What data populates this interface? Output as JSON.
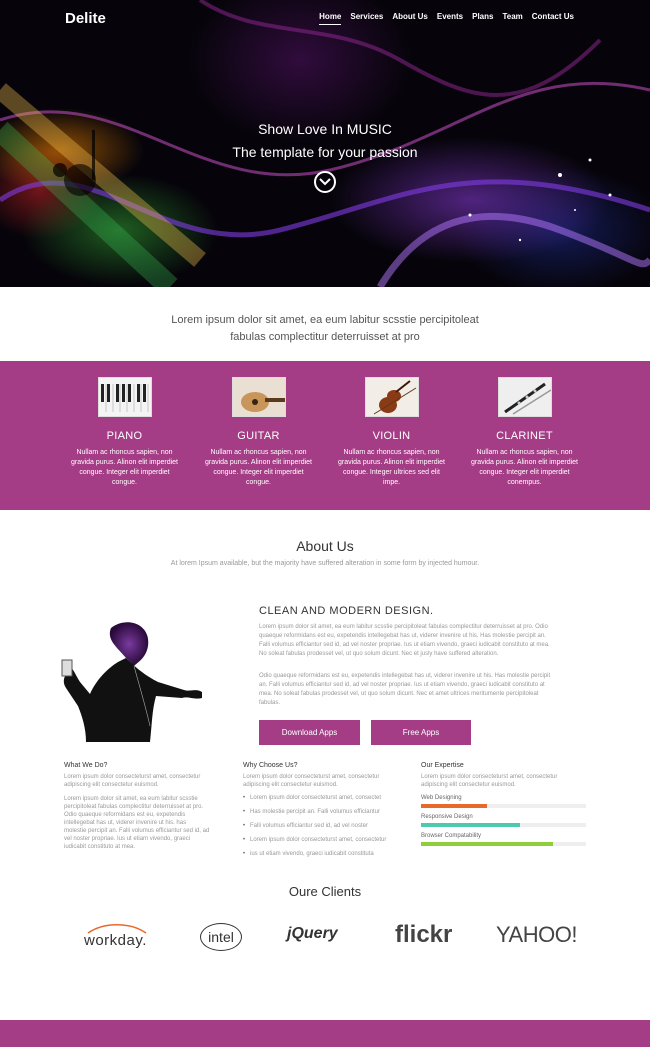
{
  "brand": "Delite",
  "nav": [
    "Home",
    "Services",
    "About Us",
    "Events",
    "Plans",
    "Team",
    "Contact Us"
  ],
  "hero": {
    "line1": "Show Love In MUSIC",
    "line2": "The template for your passion"
  },
  "intro": {
    "line1": "Lorem ipsum dolor sit amet, ea eum labitur scsstie percipitoleat",
    "line2": "fabulas complectitur deterruisset at pro"
  },
  "instruments": [
    {
      "name": "PIANO",
      "desc": [
        "Nullam ac rhoncus sapien, non",
        "gravida purus. Alinon elit imperdiet",
        "congue. Integer elit imperdiet",
        "congue."
      ]
    },
    {
      "name": "GUITAR",
      "desc": [
        "Nullam ac rhoncus sapien, non",
        "gravida purus. Alinon elit imperdiet",
        "congue. Integer elit imperdiet",
        "congue."
      ]
    },
    {
      "name": "VIOLIN",
      "desc": [
        "Nullam ac rhoncus sapien, non",
        "gravida purus. Alinon elit imperdiet",
        "congue. Integer ultrices sed elit",
        "impe."
      ]
    },
    {
      "name": "CLARINET",
      "desc": [
        "Nullam ac rhoncus sapien, non",
        "gravida purus. Alinon elit imperdiet",
        "congue. Integer elit imperdiet",
        "conempus."
      ]
    }
  ],
  "about": {
    "title": "About Us",
    "subtitle": "At lorem Ipsum available, but the majority have suffered alteration in some form by injected humour.",
    "design_title": "CLEAN AND MODERN DESIGN.",
    "para1": [
      "Lorem ipsum dolor sit amet, ea eum labitur scsstie percipitoleat fabulas complectitur deterruisset at pro. Odio",
      "quaeque reformidans est eu, expetendis intellegebat has ut, viderer invenire ut his. Has molestie percipit an.",
      "Falli volumus efficiantur sed id, ad vel noster propriae. Ius ut etiam vivendo, graeci iudicabit constituto at mea.",
      "No soleat fabulas prodesset vel, ut quo solum dicunt. Nec et jusly have suffered alteration."
    ],
    "para2": [
      "Odio quaeque reformidans est eu, expetendis intellegebat has ut, viderer invenire ut his. Has molestie percipit",
      "an. Falli volumus efficiantur sed id, ad vel noster propriae. Ius ut etiam vivendo, graeci iudicabit constituto at",
      "mea. No soleat fabulas prodesset vel, ut quo solum dicunt. Nec et amet ultrices meritumente percipitoleat",
      "fabulas."
    ],
    "btn1": "Download Apps",
    "btn2": "Free Apps"
  },
  "cols": {
    "c1": {
      "title": "What We Do?",
      "t1": [
        "Lorem ipsum dolor consecteturst amet, consectetur",
        "adipiscing elit consectetur euismod."
      ],
      "t2": [
        "Lorem ipsum dolor sit amet, ea eum labitur scsstie",
        "percipitoleat fabulas complectitur deterruisset at pro.",
        "Odio quaeque reformidans est eu, expetendis",
        "intellegebat has ut, viderer invenire ut his. has",
        "molestie percipit an. Falli volumus efficiantur sed id, ad",
        "vel noster propriae. Ius ut etiam vivendo, graeci",
        "iudicabit constituto at mea."
      ]
    },
    "c2": {
      "title": "Why Choose Us?",
      "t1": [
        "Lorem ipsum dolor consecteturst amet, consectetur",
        "adipiscing elit consectetur euismod."
      ],
      "items": [
        "Lorem ipsum dolor consecteturst amet, consectet",
        "Has molestie percipit an. Falli volumus efficiantur",
        "Falli volumus efficiantur sed id, ad vel noster",
        "Lorem ipsum dolor consecteturst amet, consectetur",
        "ius ut etiam vivendo, graeci iudicabit constituta"
      ]
    },
    "c3": {
      "title": "Our Expertise",
      "t1": [
        "Lorem ipsum dolor consecteturst amet, consectetur",
        "adipiscing elit consectetur euismod."
      ],
      "skills": [
        {
          "label": "Web Designing",
          "value": 40,
          "color": "#e8692c"
        },
        {
          "label": "Responsive Design",
          "value": 60,
          "color": "#4ec9b0"
        },
        {
          "label": "Browser Compatability",
          "value": 80,
          "color": "#8fcf3c"
        }
      ]
    }
  },
  "clients": {
    "title": "Oure Clients",
    "logos": [
      "workday.",
      "intel",
      "jQuery",
      "flickr",
      "YAHOO!"
    ]
  },
  "colors": {
    "accent": "#a53c86"
  }
}
